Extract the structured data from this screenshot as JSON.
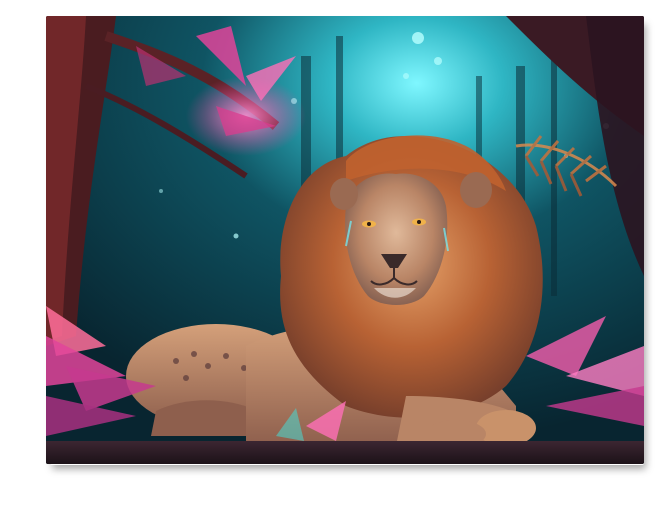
{
  "artwork": {
    "subject": "lion",
    "palette": {
      "background_teal": "#0f4a56",
      "glow_cyan": "#6ff3ff",
      "foliage_magenta": "#e0449a",
      "foliage_pink": "#ff6fb8",
      "mane_orange": "#b5562a",
      "mane_light": "#d98a4e",
      "fur_tan": "#c9926a",
      "ground_dark": "#2a1c24"
    },
    "icons": [
      "lion-figure",
      "tree-trunk",
      "fern-leaf"
    ]
  }
}
